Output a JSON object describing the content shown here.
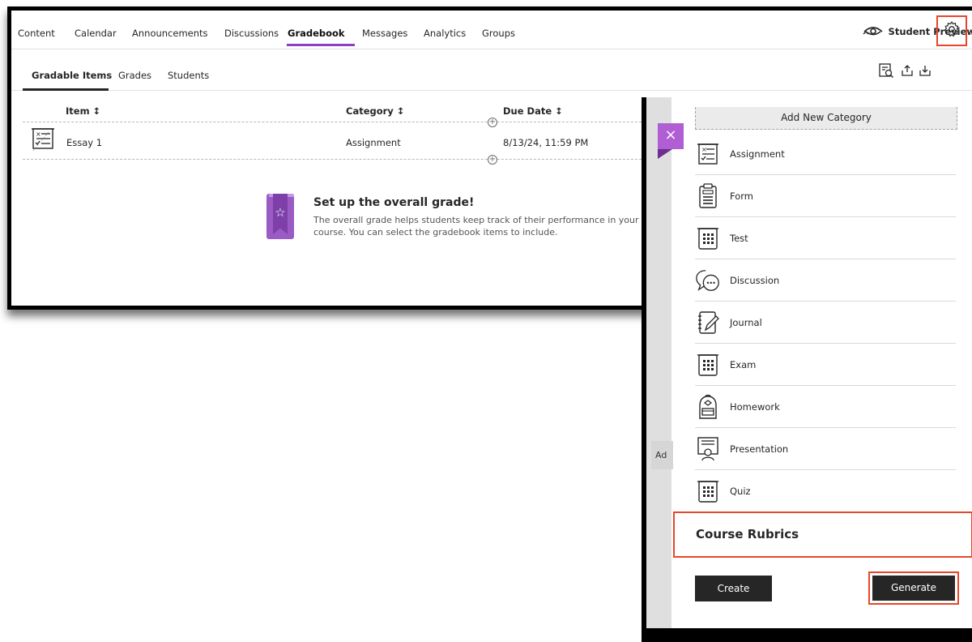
{
  "topnav": {
    "tabs": [
      "Content",
      "Calendar",
      "Announcements",
      "Discussions",
      "Gradebook",
      "Messages",
      "Analytics",
      "Groups"
    ],
    "active_tab": "Gradebook",
    "student_preview_label": "Student Preview"
  },
  "subnav": {
    "tabs": [
      "Gradable Items",
      "Grades",
      "Students"
    ],
    "active_tab": "Gradable Items"
  },
  "table": {
    "columns": [
      "Item ↕",
      "Category ↕",
      "Due Date ↕"
    ],
    "rows": [
      {
        "item": "Essay 1",
        "category": "Assignment",
        "due": "8/13/24, 11:59 PM"
      }
    ]
  },
  "overall_grade": {
    "title": "Set up the overall grade!",
    "body": "The overall grade helps students keep track of their performance in your course. You can select the gradebook items to include."
  },
  "panel": {
    "close_glyph": "×",
    "add_new_category": "Add New Category",
    "stub_text": "Ad",
    "categories": [
      {
        "label": "Assignment",
        "icon": "assignment-icon"
      },
      {
        "label": "Form",
        "icon": "form-icon"
      },
      {
        "label": "Test",
        "icon": "test-icon"
      },
      {
        "label": "Discussion",
        "icon": "discussion-icon"
      },
      {
        "label": "Journal",
        "icon": "journal-icon"
      },
      {
        "label": "Exam",
        "icon": "exam-icon"
      },
      {
        "label": "Homework",
        "icon": "homework-icon"
      },
      {
        "label": "Presentation",
        "icon": "presentation-icon"
      },
      {
        "label": "Quiz",
        "icon": "quiz-icon"
      }
    ],
    "course_rubrics": "Course Rubrics",
    "create_label": "Create",
    "generate_label": "Generate"
  },
  "colors": {
    "accent_purple": "#8f3fc7",
    "highlight_red": "#e8462a",
    "button_dark": "#262626"
  }
}
